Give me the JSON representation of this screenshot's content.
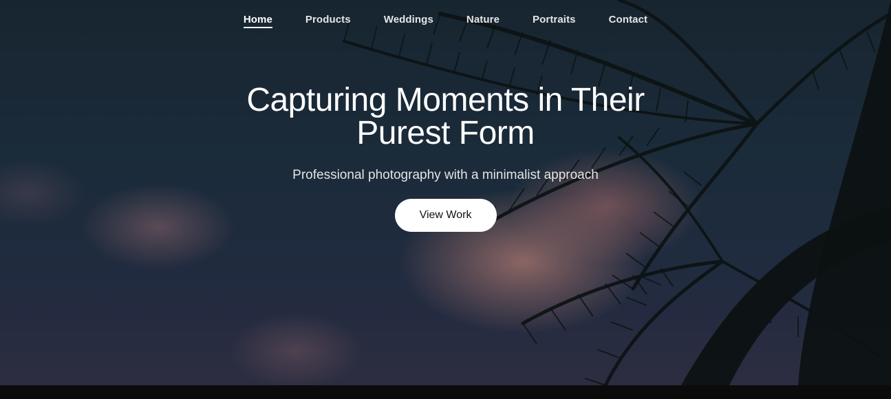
{
  "nav": {
    "items": [
      {
        "label": "Home",
        "active": true
      },
      {
        "label": "Products",
        "active": false
      },
      {
        "label": "Weddings",
        "active": false
      },
      {
        "label": "Nature",
        "active": false
      },
      {
        "label": "Portraits",
        "active": false
      },
      {
        "label": "Contact",
        "active": false
      }
    ]
  },
  "hero": {
    "title": "Capturing Moments in Their Purest Form",
    "subtitle": "Professional photography with a minimalist approach",
    "cta_label": "View Work",
    "background": "palm-trees-sunset-sky-photo"
  },
  "colors": {
    "text": "#ffffff",
    "button_bg": "#ffffff",
    "button_text": "#111111",
    "footer_strip": "#0b0b0b"
  }
}
